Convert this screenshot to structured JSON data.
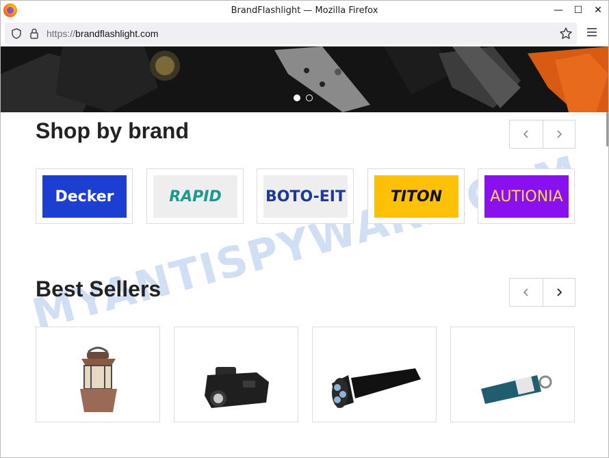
{
  "window": {
    "title": "BrandFlashlight — Mozilla Firefox",
    "controls": {
      "minimize": "—",
      "maximize": "☐",
      "close": "✕"
    }
  },
  "navbar": {
    "url_protocol": "https://",
    "url_domain": "brandflashlight.com"
  },
  "hero": {
    "slides": 2,
    "active_slide": 1
  },
  "sections": {
    "brands_title": "Shop by brand",
    "bestsellers_title": "Best Sellers"
  },
  "brands": [
    {
      "name": "Decker",
      "bg": "#1c3fd1",
      "fg": "#ffffff"
    },
    {
      "name": "RAPID",
      "bg": "#eeeeee",
      "fg": "#1a9a8e"
    },
    {
      "name": "BOTO-EIT",
      "bg": "#eeeeee",
      "fg": "#1f3a96"
    },
    {
      "name": "TITON",
      "bg": "#ffc107",
      "fg": "#111111"
    },
    {
      "name": "AUTIONIA",
      "bg": "#8a10f0",
      "fg": "#ffd84a"
    }
  ],
  "products": [
    {
      "name": "lantern"
    },
    {
      "name": "weapon-light"
    },
    {
      "name": "dive-flashlight"
    },
    {
      "name": "keychain-flashlight"
    }
  ],
  "watermark": "MYANTISPYWARE.COM"
}
